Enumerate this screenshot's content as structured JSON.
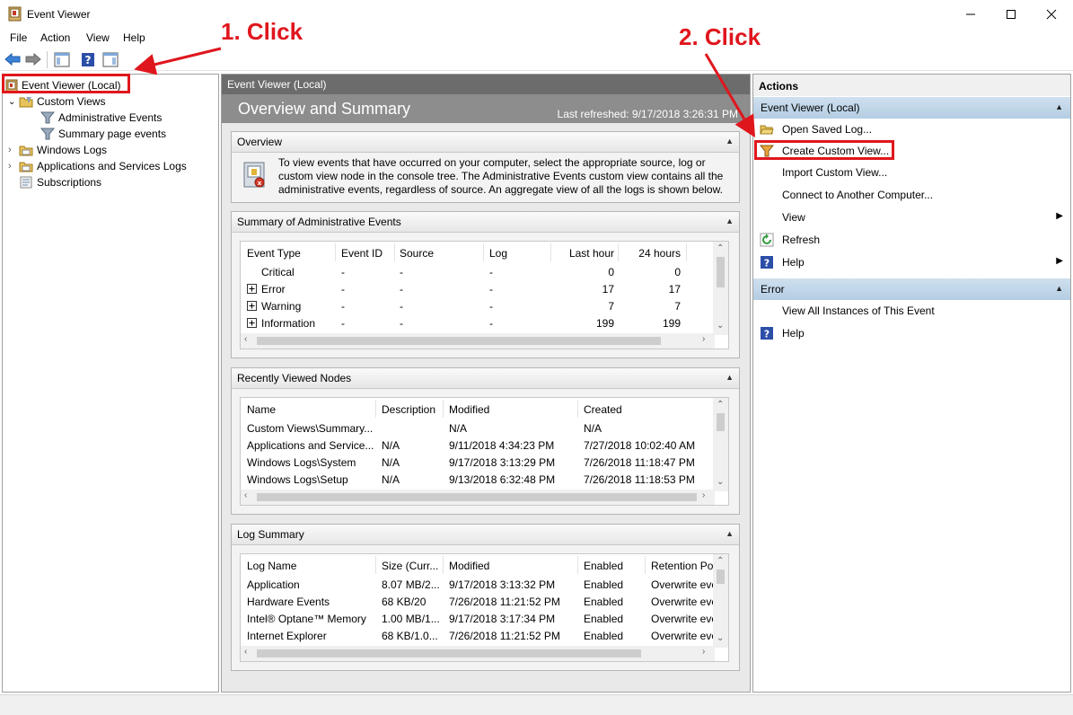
{
  "window": {
    "title": "Event Viewer"
  },
  "menu": [
    "File",
    "Action",
    "View",
    "Help"
  ],
  "tree": {
    "root": "Event Viewer (Local)",
    "custom_views": "Custom Views",
    "administrative_events": "Administrative Events",
    "summary_page_events": "Summary page events",
    "windows_logs": "Windows Logs",
    "app_services_logs": "Applications and Services Logs",
    "subscriptions": "Subscriptions"
  },
  "center": {
    "header": "Event Viewer (Local)",
    "band_title": "Overview and Summary",
    "last_refreshed": "Last refreshed: 9/17/2018 3:26:31 PM",
    "overview": {
      "title": "Overview",
      "text": "To view events that have occurred on your computer, select the appropriate source, log or custom view node in the console tree. The Administrative Events custom view contains all the administrative events, regardless of source. An aggregate view of all the logs is shown below."
    },
    "summary": {
      "title": "Summary of Administrative Events",
      "columns": [
        "Event Type",
        "Event ID",
        "Source",
        "Log",
        "Last hour",
        "24 hours"
      ],
      "rows": [
        {
          "type": "Critical",
          "id": "-",
          "source": "-",
          "log": "-",
          "last_hour": "0",
          "h24": "0",
          "expandable": false
        },
        {
          "type": "Error",
          "id": "-",
          "source": "-",
          "log": "-",
          "last_hour": "17",
          "h24": "17",
          "expandable": true
        },
        {
          "type": "Warning",
          "id": "-",
          "source": "-",
          "log": "-",
          "last_hour": "7",
          "h24": "7",
          "expandable": true
        },
        {
          "type": "Information",
          "id": "-",
          "source": "-",
          "log": "-",
          "last_hour": "199",
          "h24": "199",
          "expandable": true
        }
      ]
    },
    "recent": {
      "title": "Recently Viewed Nodes",
      "columns": [
        "Name",
        "Description",
        "Modified",
        "Created"
      ],
      "rows": [
        {
          "name": "Custom Views\\Summary...",
          "desc": "",
          "modified": "N/A",
          "created": "N/A"
        },
        {
          "name": "Applications and Service...",
          "desc": "N/A",
          "modified": "9/11/2018 4:34:23 PM",
          "created": "7/27/2018 10:02:40 AM"
        },
        {
          "name": "Windows Logs\\System",
          "desc": "N/A",
          "modified": "9/17/2018 3:13:29 PM",
          "created": "7/26/2018 11:18:47 PM"
        },
        {
          "name": "Windows Logs\\Setup",
          "desc": "N/A",
          "modified": "9/13/2018 6:32:48 PM",
          "created": "7/26/2018 11:18:53 PM"
        }
      ]
    },
    "logsummary": {
      "title": "Log Summary",
      "columns": [
        "Log Name",
        "Size (Curr...",
        "Modified",
        "Enabled",
        "Retention Po"
      ],
      "rows": [
        {
          "name": "Application",
          "size": "8.07 MB/2...",
          "modified": "9/17/2018 3:13:32 PM",
          "enabled": "Enabled",
          "retention": "Overwrite eve"
        },
        {
          "name": "Hardware Events",
          "size": "68 KB/20",
          "modified": "7/26/2018 11:21:52 PM",
          "enabled": "Enabled",
          "retention": "Overwrite eve"
        },
        {
          "name": "Intel® Optane™ Memory",
          "size": "1.00 MB/1...",
          "modified": "9/17/2018 3:17:34 PM",
          "enabled": "Enabled",
          "retention": "Overwrite eve"
        },
        {
          "name": "Internet Explorer",
          "size": "68 KB/1.0...",
          "modified": "7/26/2018 11:21:52 PM",
          "enabled": "Enabled",
          "retention": "Overwrite eve"
        }
      ]
    }
  },
  "actions": {
    "title": "Actions",
    "group1": "Event Viewer (Local)",
    "items1": [
      "Open Saved Log...",
      "Create Custom View...",
      "Import Custom View...",
      "Connect to Another Computer...",
      "View",
      "Refresh",
      "Help"
    ],
    "group2": "Error",
    "items2": [
      "View All Instances of This Event",
      "Help"
    ]
  },
  "annotations": {
    "step1": "1. Click",
    "step2": "2. Click"
  },
  "colors": {
    "annotation_red": "#e0161d",
    "group_blue": "#c2d6ea"
  }
}
